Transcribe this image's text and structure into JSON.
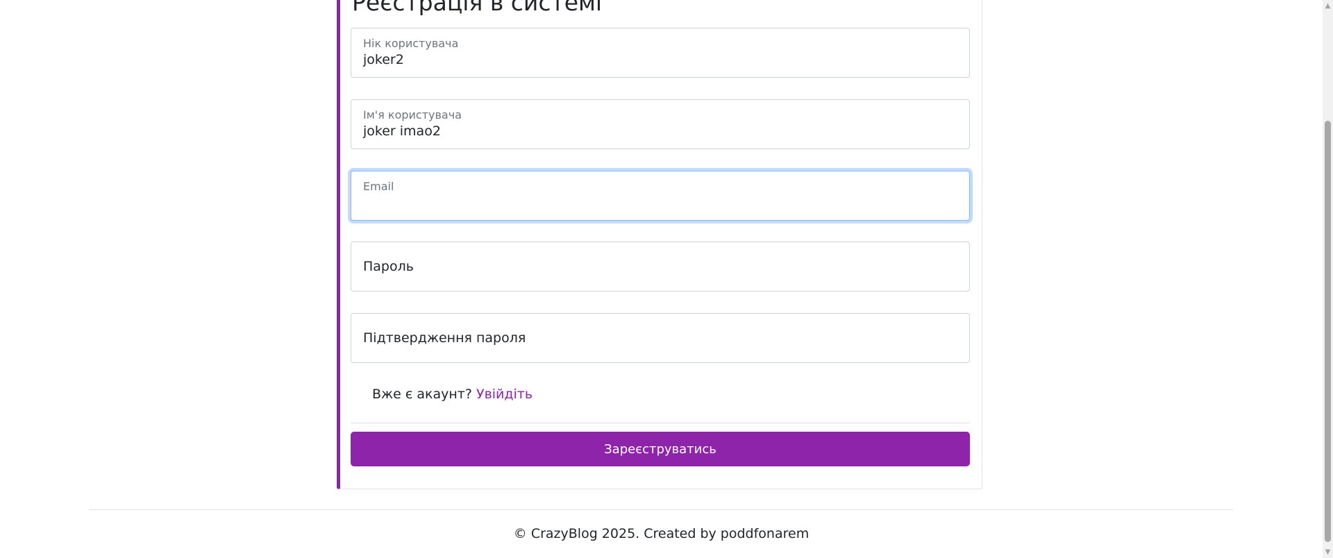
{
  "form": {
    "title": "Реєстрація в системі",
    "fields": [
      {
        "label": "Нік користувача",
        "value": "joker2"
      },
      {
        "label": "Ім'я користувача",
        "value": "joker imao2"
      },
      {
        "label": "Email",
        "value": ""
      },
      {
        "label": "Пароль",
        "value": ""
      },
      {
        "label": "Підтвердження пароля",
        "value": ""
      }
    ],
    "account_prompt": "Вже є акаунт?",
    "login_link": "Увійдіть",
    "submit_label": "Зареєструватись"
  },
  "footer": {
    "text": "© CrazyBlog 2025. Created by poddfonarem"
  },
  "scrollbar": {
    "up_arrow": "▲",
    "down_arrow": "▼"
  },
  "colors": {
    "accent": "#8e24aa",
    "focus": "#86b7fe"
  }
}
